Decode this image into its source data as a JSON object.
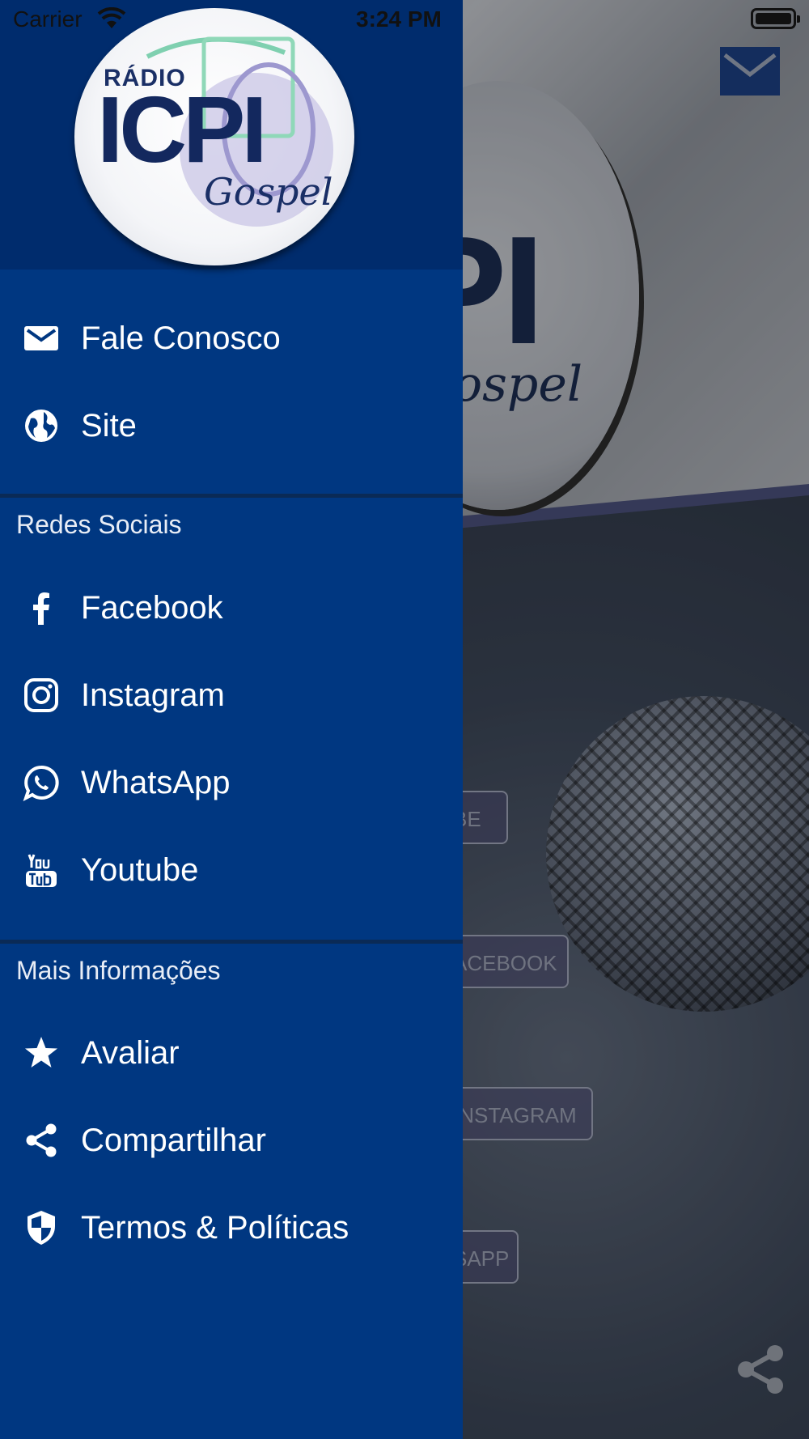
{
  "status_bar": {
    "carrier": "Carrier",
    "time": "3:24 PM"
  },
  "background_app": {
    "buttons": [
      "BE",
      "ACEBOOK",
      "INSTAGRAM",
      "SAPP"
    ],
    "logo_text": "PI",
    "logo_sub": "ospel",
    "icons": [
      "mail-icon",
      "share-icon",
      "microphone-image"
    ]
  },
  "drawer": {
    "logo": {
      "line1": "RÁDIO",
      "line2": "ICPI",
      "line3": "Gospel"
    },
    "top_items": [
      {
        "label": "Fale Conosco",
        "icon": "mail-icon"
      },
      {
        "label": "Site",
        "icon": "globe-icon"
      }
    ],
    "social_section": {
      "title": "Redes Sociais",
      "items": [
        {
          "label": "Facebook",
          "icon": "facebook-icon"
        },
        {
          "label": "Instagram",
          "icon": "instagram-icon"
        },
        {
          "label": "WhatsApp",
          "icon": "whatsapp-icon"
        },
        {
          "label": "Youtube",
          "icon": "youtube-icon"
        }
      ]
    },
    "info_section": {
      "title": "Mais Informações",
      "items": [
        {
          "label": "Avaliar",
          "icon": "star-icon"
        },
        {
          "label": "Compartilhar",
          "icon": "share-icon"
        },
        {
          "label": "Termos & Políticas",
          "icon": "shield-icon"
        }
      ]
    }
  },
  "colors": {
    "drawer_bg": "#003781",
    "drawer_header_bg": "#002c6d",
    "text": "#ffffff"
  }
}
